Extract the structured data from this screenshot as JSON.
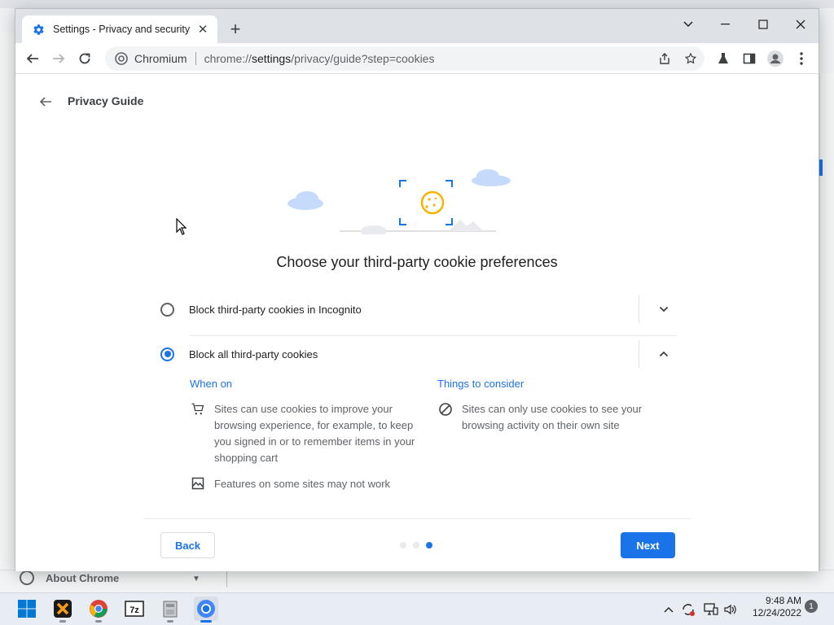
{
  "tab": {
    "title": "Settings - Privacy and security",
    "close": "✕",
    "new_tab": "+"
  },
  "omnibox": {
    "site_name": "Chromium",
    "url_prefix": "chrome://",
    "url_host": "settings",
    "url_path": "/privacy/guide?step=cookies"
  },
  "page": {
    "title": "Privacy Guide",
    "heading": "Choose your third-party cookie preferences",
    "options": [
      {
        "label": "Block third-party cookies in Incognito",
        "selected": false,
        "expanded": false
      },
      {
        "label": "Block all third-party cookies",
        "selected": true,
        "expanded": true
      }
    ],
    "when_on": {
      "heading": "When on",
      "items": [
        {
          "icon": "shopping-cart-icon",
          "text": "Sites can use cookies to improve your browsing experience, for example, to keep you signed in or to remember items in your shopping cart"
        },
        {
          "icon": "broken-image-icon",
          "text": "Features on some sites may not work"
        }
      ]
    },
    "consider": {
      "heading": "Things to consider",
      "items": [
        {
          "icon": "block-icon",
          "text": "Sites can only use cookies to see your browsing activity on their own site"
        }
      ]
    },
    "back_label": "Back",
    "next_label": "Next",
    "steps_total": 3,
    "step_current": 3
  },
  "background": {
    "about_label": "About Chrome"
  },
  "taskbar": {
    "time": "9:48 AM",
    "date": "12/24/2022",
    "notifications": "1",
    "apps": [
      "start-icon",
      "xampp-icon",
      "chrome-icon",
      "7zip-icon",
      "installer-icon",
      "chromium-icon"
    ]
  },
  "colors": {
    "accent": "#1a73e8",
    "cookie": "#f4b400"
  }
}
